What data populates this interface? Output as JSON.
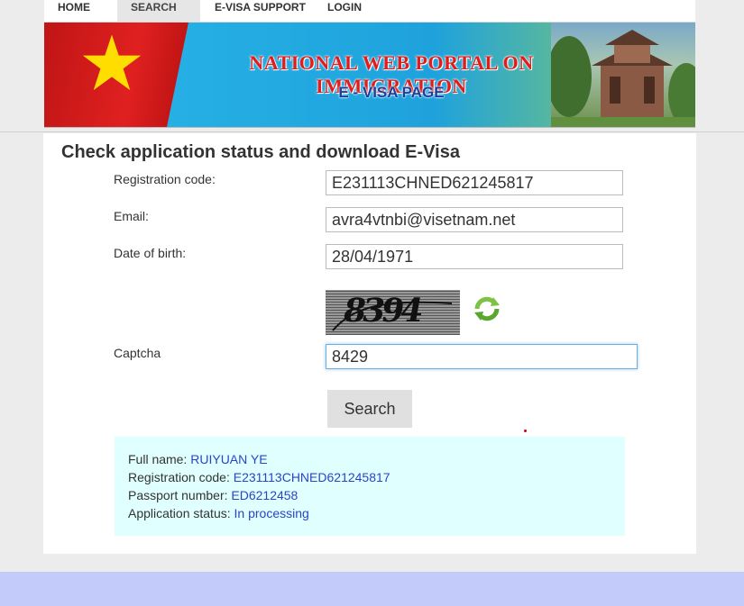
{
  "nav": {
    "items": [
      {
        "label": "HOME"
      },
      {
        "label": "SEARCH"
      },
      {
        "label": "E-VISA SUPPORT"
      },
      {
        "label": "LOGIN"
      }
    ]
  },
  "banner": {
    "title": "NATIONAL WEB PORTAL ON IMMIGRATION",
    "subtitle": "E - VISA PAGE"
  },
  "form": {
    "title": "Check application status and download E-Visa",
    "registration_label": "Registration code:",
    "registration_value": "E231113CHNED621245817",
    "email_label": "Email:",
    "email_value": "avra4vtnbi@visetnam.net",
    "dob_label": "Date of birth:",
    "dob_value": "28/04/1971",
    "captcha_image_text": "8394",
    "captcha_label": "Captcha",
    "captcha_value": "8429",
    "search_button": "Search"
  },
  "result": {
    "full_name_label": "Full name: ",
    "full_name_value": "RUIYUAN YE",
    "registration_label": "Registration code: ",
    "registration_value": "E231113CHNED621245817",
    "passport_label": "Passport number: ",
    "passport_value": "ED6212458",
    "status_label": "Application status: ",
    "status_value": "In processing"
  },
  "colors": {
    "link": "#2b44c6",
    "result_bg": "#e0ffff",
    "footer_band": "#c2cbf9"
  }
}
